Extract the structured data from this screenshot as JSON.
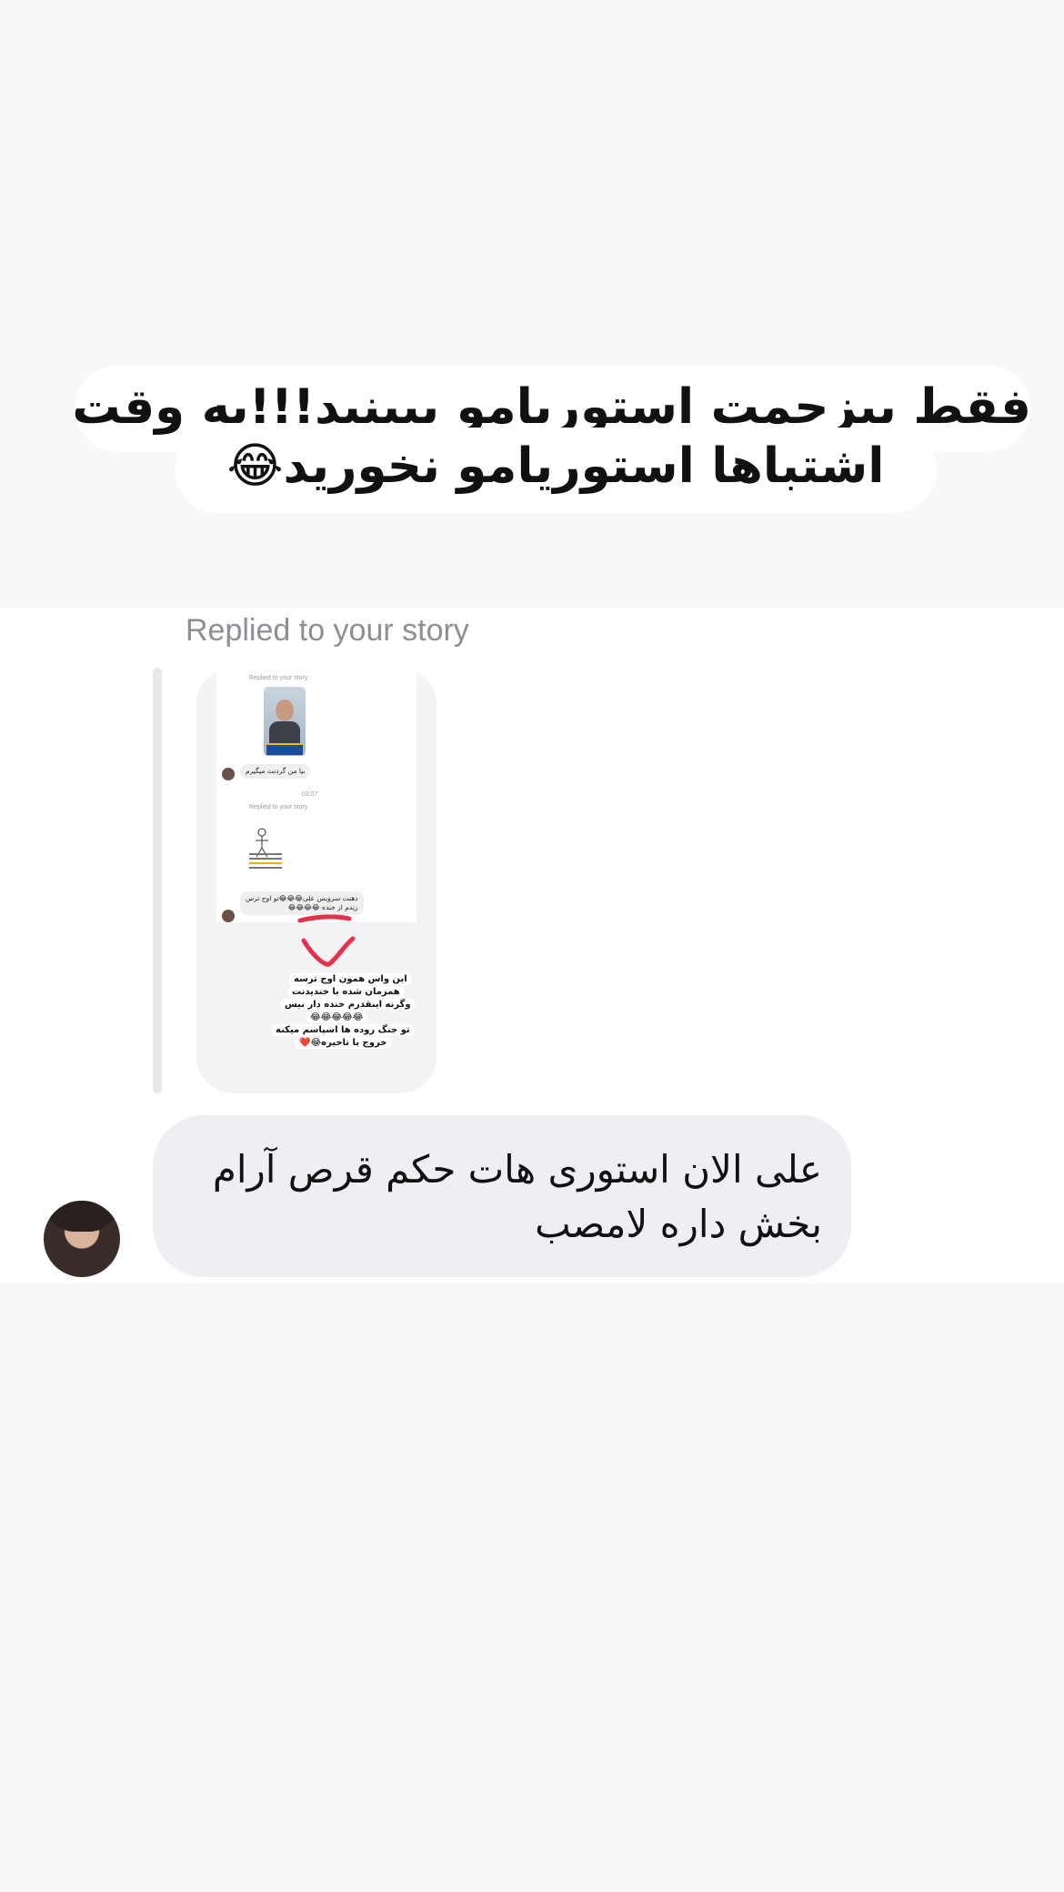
{
  "story_caption": {
    "line1": "فقط بیزحمت استوریامو ببینید!!!یه وقت",
    "line2": "اشتباها استوریامو نخورید😂"
  },
  "thread": {
    "replied_label": "Replied to your story",
    "story_preview": {
      "mini_replied_1": "Replied to your story",
      "mini_msg_1": "بیا من گردنت میگیرم",
      "mini_time": "03:07",
      "mini_replied_2": "Replied to your story",
      "mini_msg_2": "دهنت سرویس علی😂😂😂تو اوج ترس",
      "mini_msg_3": "ریدم از خنده 😂😂😂😂",
      "meme_1": "این واس همون اوج ترسه",
      "meme_2": "همزمان شده با خندیدنت",
      "meme_3": "وگرنه اینقدرم خنده دار نیس",
      "meme_4": "😂😂😂😂😂",
      "meme_5": "تو جنگ روده ها اسپاسم میکنه",
      "meme_6": "خروج با تاخیره😂❤️"
    },
    "message": {
      "line1": "علی الان استوری هات حکم قرص آرام",
      "line2": "بخش داره لامصب"
    }
  }
}
